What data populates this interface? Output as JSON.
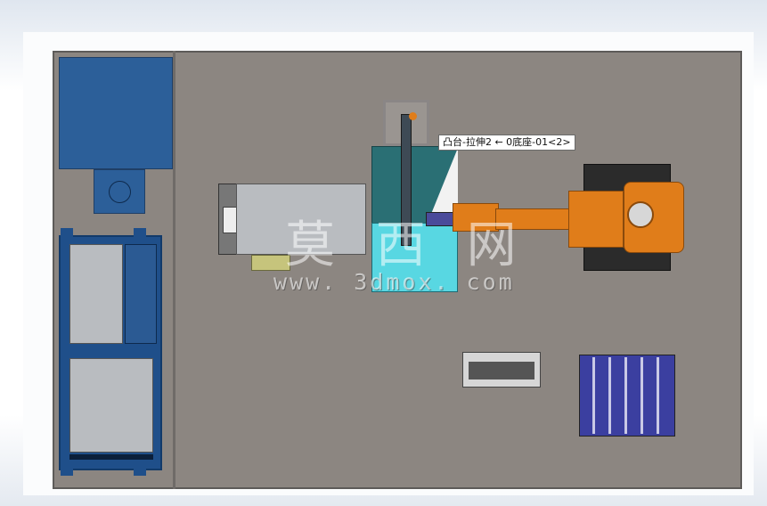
{
  "viewport": {
    "name": "cad-graphics-area",
    "component_label": "凸台-拉伸2 ← 0底座-01<2>",
    "watermark": {
      "chinese": "莫 西 网",
      "url": "www. 3dmox. com"
    }
  },
  "colors": {
    "base_plate": "#8c8681",
    "cabinet_blue": "#2c5f99",
    "robot_orange": "#e07d1a",
    "vision_cyan": "#5ee3ee",
    "pallet_purple": "#3b3fa0"
  }
}
